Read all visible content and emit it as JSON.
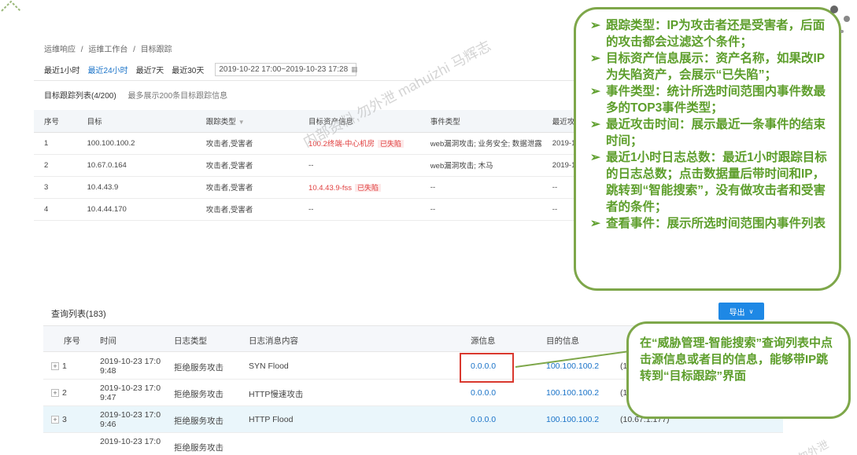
{
  "breadcrumb": [
    "运维响应",
    "/",
    "运维工作台",
    "/",
    "目标跟踪"
  ],
  "time_filter": {
    "options": [
      "最近1小时",
      "最近24小时",
      "最近7天",
      "最近30天"
    ],
    "active_index": 1,
    "date_range": "2019-10-22 17:00~2019-10-23 17:28"
  },
  "tracking_list": {
    "title": "目标跟踪列表(4/200)",
    "subtitle": "最多展示200条目标跟踪信息",
    "columns": [
      "序号",
      "目标",
      "跟踪类型",
      "目标资产信息",
      "事件类型",
      "最近攻"
    ],
    "rows": [
      {
        "no": "1",
        "target": "100.100.100.2",
        "type": "攻击者,受害者",
        "asset": "100.2终端-中心机房",
        "asset_tag": "已失陷",
        "event": "web漏洞攻击; 业务安全; 数据泄露",
        "recent": "2019-1"
      },
      {
        "no": "2",
        "target": "10.67.0.164",
        "type": "攻击者,受害者",
        "asset": "--",
        "asset_tag": "",
        "event": "web漏洞攻击; 木马",
        "recent": "2019-1"
      },
      {
        "no": "3",
        "target": "10.4.43.9",
        "type": "攻击者,受害者",
        "asset": "10.4.43.9-fss",
        "asset_tag": "已失陷",
        "event": "--",
        "recent": "--"
      },
      {
        "no": "4",
        "target": "10.4.44.170",
        "type": "攻击者,受害者",
        "asset": "--",
        "asset_tag": "",
        "event": "--",
        "recent": "--"
      }
    ]
  },
  "query_list": {
    "title": "查询列表(183)",
    "export_label": "导出",
    "columns": [
      "序号",
      "时间",
      "日志类型",
      "日志消息内容",
      "源信息",
      "目的信息"
    ],
    "rows": [
      {
        "no": "1",
        "time_a": "2019-10-23 17:0",
        "time_b": "9:48",
        "log_type": "拒绝服务攻击",
        "content": "SYN Flood",
        "src": "0.0.0.0",
        "dst": "100.100.100.2",
        "extra": "(1"
      },
      {
        "no": "2",
        "time_a": "2019-10-23 17:0",
        "time_b": "9:47",
        "log_type": "拒绝服务攻击",
        "content": "HTTP慢速攻击",
        "src": "0.0.0.0",
        "dst": "100.100.100.2",
        "extra": "(1"
      },
      {
        "no": "3",
        "time_a": "2019-10-23 17:0",
        "time_b": "9:46",
        "log_type": "拒绝服务攻击",
        "content": "HTTP Flood",
        "src": "0.0.0.0",
        "dst": "100.100.100.2",
        "extra": "(10.67.1.177)"
      },
      {
        "no": "",
        "time_a": "2019-10-23 17:0",
        "time_b": "",
        "log_type": "拒绝服务攻击",
        "content": "",
        "src": "",
        "dst": "",
        "extra": ""
      }
    ]
  },
  "callout_main": [
    "跟踪类型：IP为攻击者还是受害者，后面的攻击都会过滤这个条件；",
    "目标资产信息展示：资产名称，如果改IP为失陷资产，会展示“已失陷”；",
    "事件类型：统计所选时间范围内事件数最多的TOP3事件类型；",
    "最近攻击时间：展示最近一条事件的结束时间；",
    "最近1小时日志总数：最近1小时跟踪目标的日志总数；点击数据量后带时间和IP，跳转到“智能搜索”，没有做攻击者和受害者的条件；",
    "查看事件：展示所选时间范围内事件列表"
  ],
  "callout_secondary": "在“威胁管理-智能搜索”查询列表中点击源信息或者目的信息，能够带IP跳转到“目标跟踪”界面",
  "watermark": "内部资料,勿外泄 mahuizhi 马辉志",
  "watermark_corner": "勿外泄",
  "colors": {
    "accent": "#1a73c8",
    "callout_green": "#5d9e2b",
    "callout_border": "#7ea74a",
    "highlight_red": "#d9382e",
    "export_blue": "#1e88e5"
  }
}
